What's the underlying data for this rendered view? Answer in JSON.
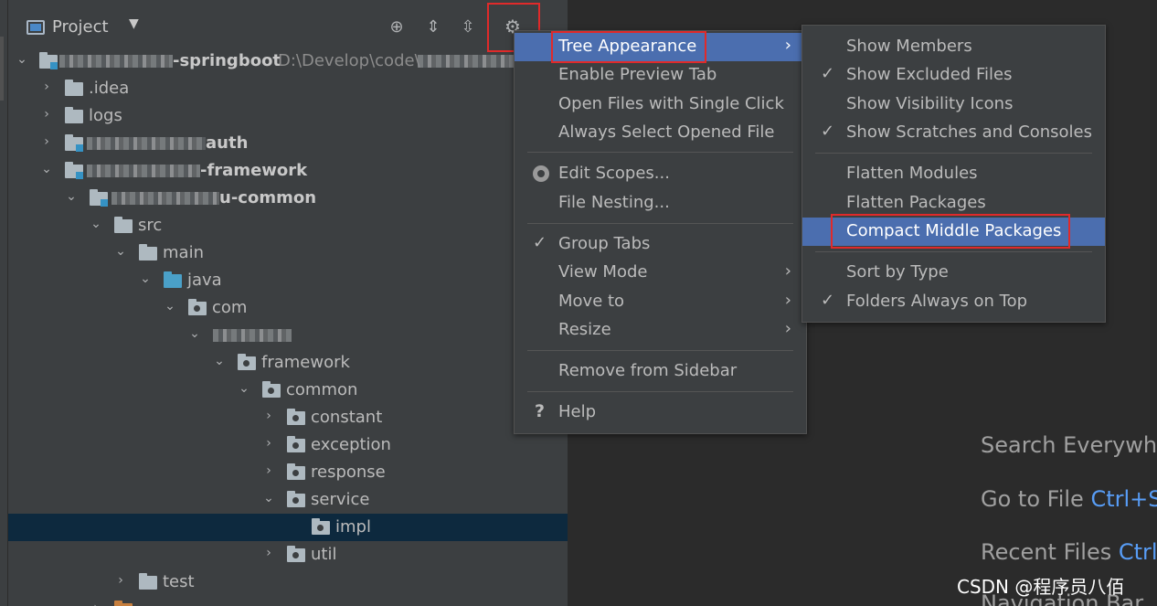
{
  "panel": {
    "title": "Project",
    "caret": "▼",
    "icons": {
      "locate": "locate-icon",
      "expand": "expand-all-icon",
      "collapse": "collapse-all-icon",
      "gear": "gear-icon"
    }
  },
  "tree": {
    "root_suffix": "-springboot",
    "root_path": "D:\\Develop\\code\\",
    "idea": ".idea",
    "logs": "logs",
    "auth_suffix": "auth",
    "framework_suffix": "-framework",
    "common_suffix": "u-common",
    "src": "src",
    "main": "main",
    "java": "java",
    "com": "com",
    "framework": "framework",
    "common": "common",
    "constant": "constant",
    "exception": "exception",
    "response": "response",
    "service": "service",
    "impl": "impl",
    "util": "util",
    "test": "test"
  },
  "menu": {
    "tree_appearance": "Tree Appearance",
    "enable_preview_tab": "Enable Preview Tab",
    "open_single_click": "Open Files with Single Click",
    "always_select": "Always Select Opened File",
    "edit_scopes": "Edit Scopes...",
    "file_nesting": "File Nesting...",
    "group_tabs": "Group Tabs",
    "view_mode": "View Mode",
    "move_to": "Move to",
    "resize": "Resize",
    "remove_sidebar": "Remove from Sidebar",
    "help": "Help",
    "submenu_arrow": "›",
    "check": "✓"
  },
  "submenu": {
    "show_members": "Show Members",
    "show_excluded": "Show Excluded Files",
    "show_visibility": "Show Visibility Icons",
    "show_scratches": "Show Scratches and Consoles",
    "flatten_modules": "Flatten Modules",
    "flatten_packages": "Flatten Packages",
    "compact_middle": "Compact Middle Packages",
    "sort_by_type": "Sort by Type",
    "folders_on_top": "Folders Always on Top"
  },
  "hints": {
    "search_everywhere": "Search Everywhe",
    "go_to_file": "Go to File",
    "go_to_file_key": "Ctrl+S",
    "recent_files": "Recent Files",
    "recent_files_key": "Ctrl",
    "navigation_bar": "Navigation Bar"
  },
  "watermark": "CSDN @程序员八佰",
  "colors": {
    "accent": "#4b6eaf",
    "highlight_box": "#e02a2a",
    "selected_row": "#0d293e",
    "shortcut": "#589df6"
  }
}
